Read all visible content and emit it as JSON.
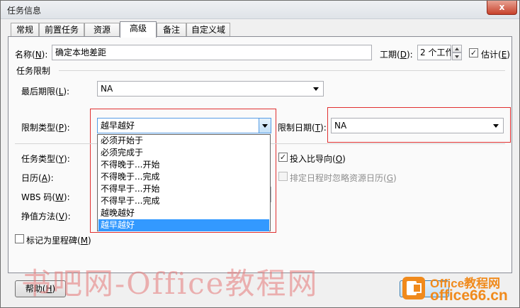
{
  "window": {
    "title": "任务信息",
    "close_glyph": "x"
  },
  "tabs": [
    {
      "label": "常规"
    },
    {
      "label": "前置任务"
    },
    {
      "label": "资源"
    },
    {
      "label": "高级"
    },
    {
      "label": "备注"
    },
    {
      "label": "自定义域"
    }
  ],
  "active_tab": "高级",
  "name_field": {
    "label_pre": "名称(",
    "key": "N",
    "label_post": "):",
    "value": "确定本地差距"
  },
  "duration_field": {
    "label_pre": "工期(",
    "key": "D",
    "label_post": "):",
    "value": "2 个工作",
    "estimated_label_pre": "估计(",
    "estimated_key": "E",
    "estimated_label_post": ")",
    "estimated_checked": true
  },
  "constraints_group": {
    "title": "任务限制"
  },
  "deadline": {
    "label_pre": "最后期限(",
    "key": "L",
    "label_post": "):",
    "value": "NA"
  },
  "constraint_type": {
    "label_pre": "限制类型(",
    "key": "P",
    "label_post": "):",
    "value": "越早越好",
    "options": [
      "必须开始于",
      "必须完成于",
      "不得晚于...开始",
      "不得晚于...完成",
      "不得早于...开始",
      "不得早于...完成",
      "越晚越好",
      "越早越好"
    ],
    "selected_index": 7
  },
  "constraint_date": {
    "label_pre": "限制日期(",
    "key": "T",
    "label_post": "):",
    "value": "NA"
  },
  "task_type": {
    "label_pre": "任务类型(",
    "key": "Y",
    "label_post": "):"
  },
  "effort_driven": {
    "label_pre": "投入比导向(",
    "key": "O",
    "label_post": ")",
    "checked": true
  },
  "calendar": {
    "label_pre": "日历(",
    "key": "A",
    "label_post": "):"
  },
  "ignore_resource_calendar": {
    "label_pre": "排定日程时忽略资源日历(",
    "key": "G",
    "label_post": ")",
    "checked": false,
    "enabled": false
  },
  "wbs_code": {
    "label_pre": "WBS 码(",
    "key": "W",
    "label_post": "):"
  },
  "earned_value": {
    "label_pre": "挣值方法(",
    "key": "V",
    "label_post": "):"
  },
  "milestone": {
    "label_pre": "标记为里程碑(",
    "key": "M",
    "label_post": ")",
    "checked": false
  },
  "buttons": {
    "help_pre": "帮助(",
    "help_key": "H",
    "help_post": ")"
  },
  "watermark": {
    "text": "书吧网-Office教程网"
  },
  "brand": {
    "line1": "Office教程网",
    "line2": "office66.cn"
  },
  "colors": {
    "highlight_box": "#e03030",
    "selection": "#3399ff",
    "brand": "#f08a1c"
  }
}
